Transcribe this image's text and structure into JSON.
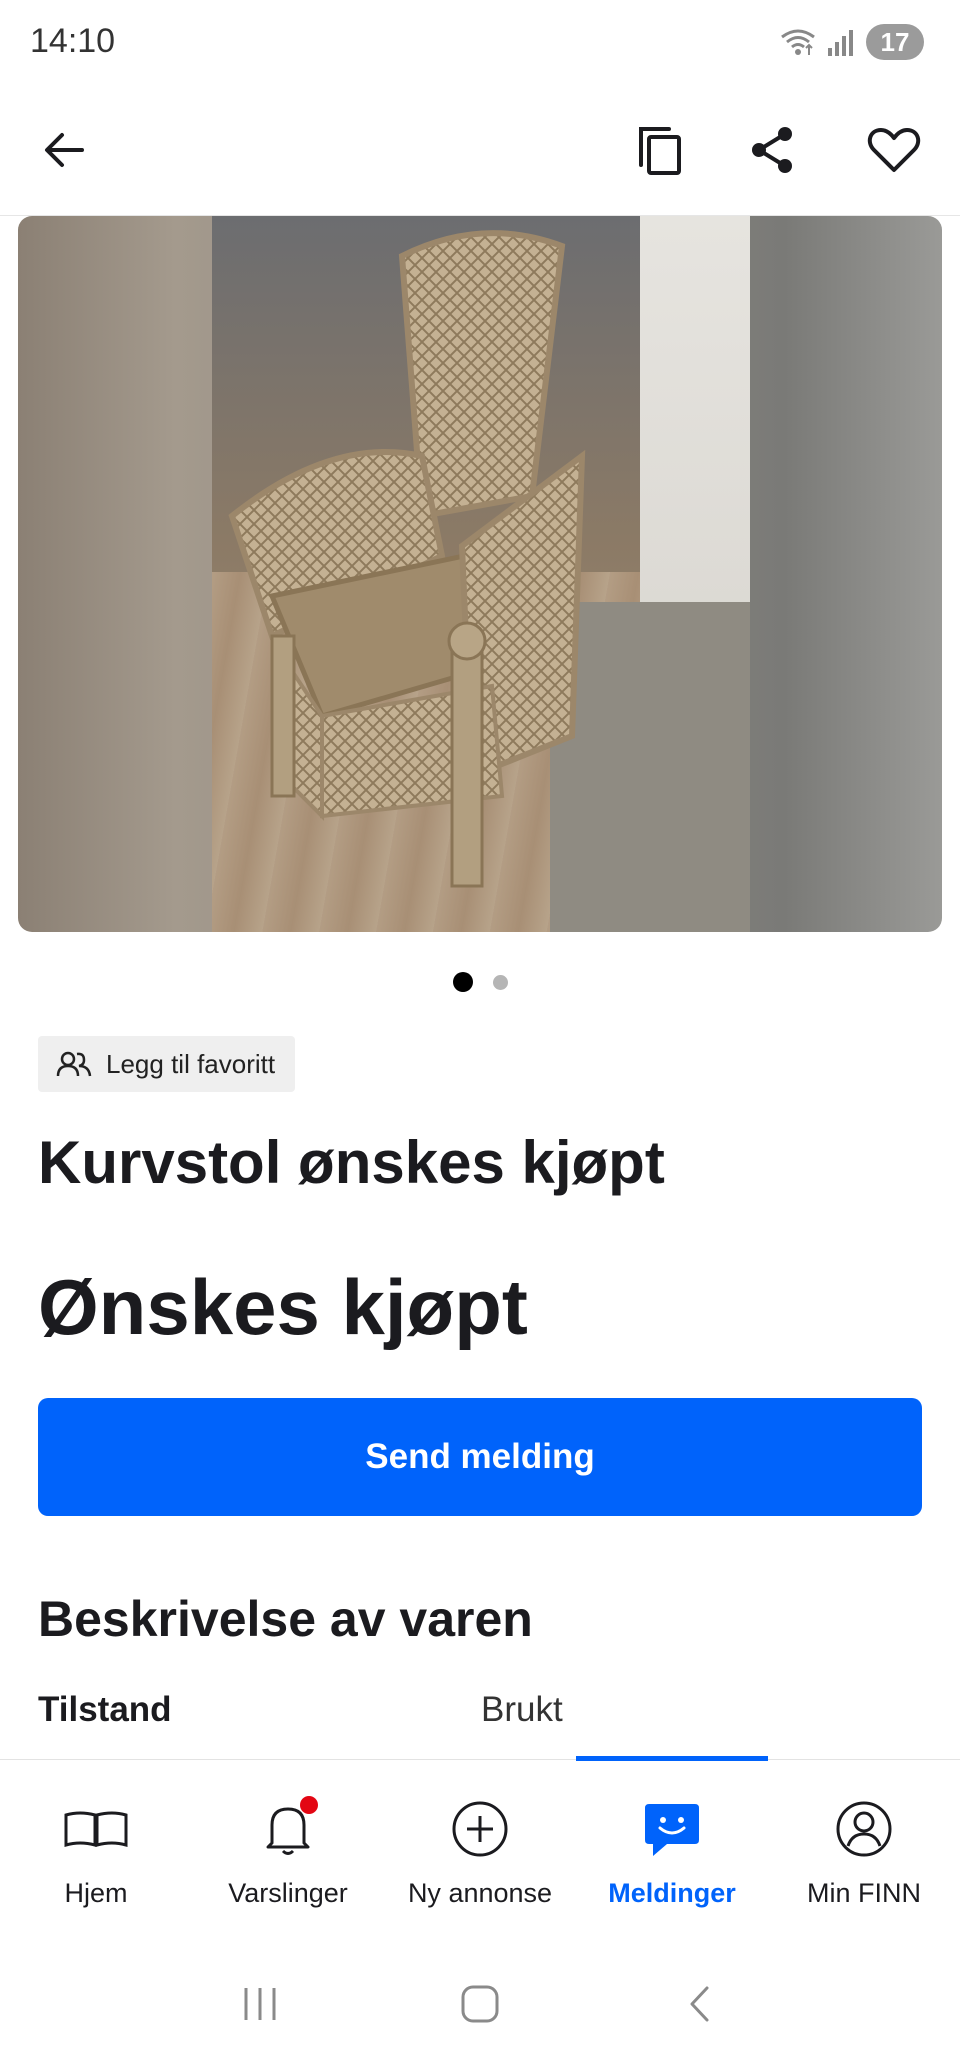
{
  "status_bar": {
    "time": "14:10",
    "battery": "17"
  },
  "top_bar": {
    "icons": [
      "arrow-left-icon",
      "copy-icon",
      "share-icon",
      "heart-icon"
    ]
  },
  "gallery": {
    "image_alt": "Kurvstol",
    "current_image": 1,
    "total_images": 2
  },
  "listing": {
    "favorite_chip_label": "Legg til favoritt",
    "title": "Kurvstol ønskes kjøpt",
    "price": "Ønskes kjøpt",
    "send_button_label": "Send melding",
    "description_heading": "Beskrivelse av varen",
    "specs": [
      {
        "label": "Tilstand",
        "value": "Brukt"
      }
    ]
  },
  "bottom_nav": {
    "items": [
      {
        "label": "Hjem",
        "icon": "book-icon",
        "active": false
      },
      {
        "label": "Varslinger",
        "icon": "bell-icon",
        "active": false,
        "badge": true
      },
      {
        "label": "Ny annonse",
        "icon": "plus-circle-icon",
        "active": false
      },
      {
        "label": "Meldinger",
        "icon": "chat-icon",
        "active": true
      },
      {
        "label": "Min FINN",
        "icon": "profile-icon",
        "active": false
      }
    ]
  },
  "colors": {
    "primary": "#0063fb",
    "badge": "#e30613",
    "text": "#1b1b1f"
  }
}
